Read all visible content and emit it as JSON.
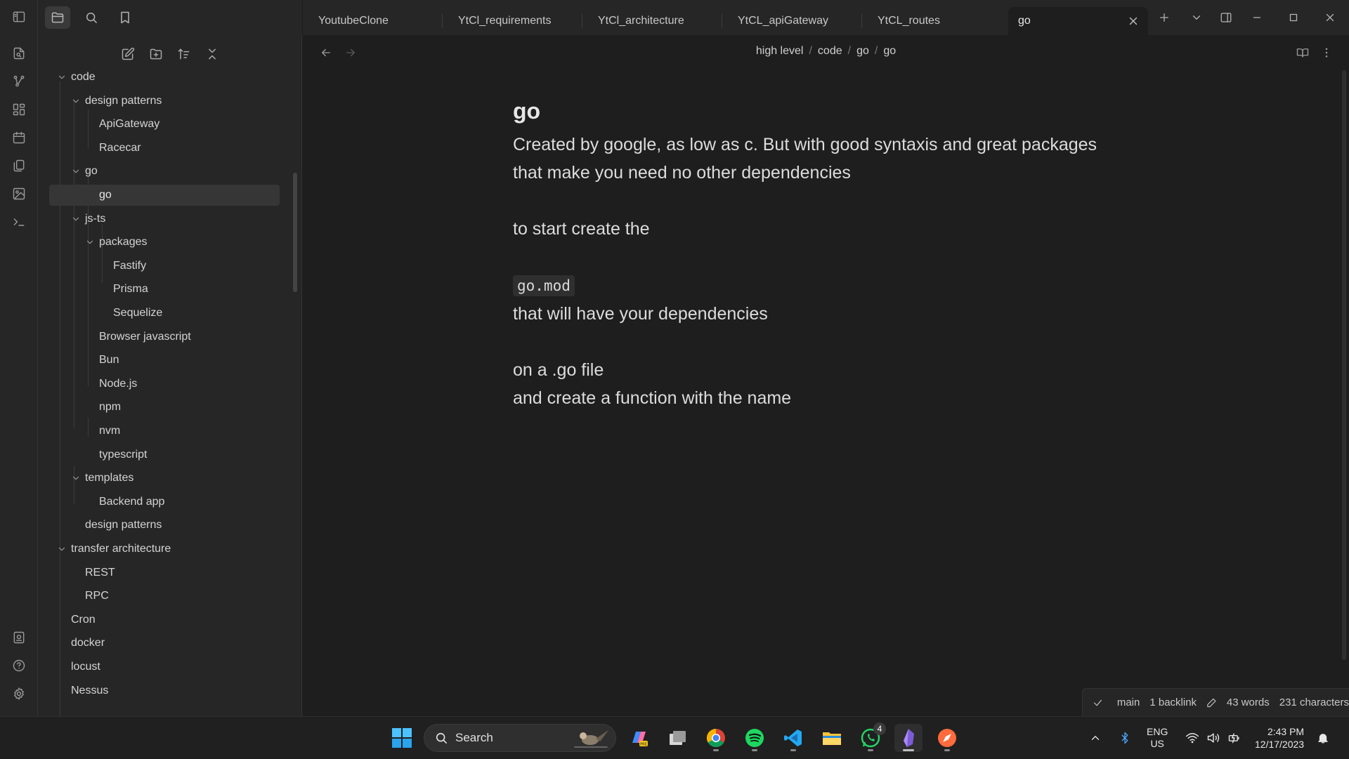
{
  "ribbon": {
    "icons": [
      "file-search-icon",
      "graph-icon",
      "canvas-icon",
      "calendar-icon",
      "pages-icon",
      "image-plot-icon",
      "terminal-icon",
      "vault-switcher-icon",
      "help-icon",
      "settings-icon"
    ]
  },
  "sidebar": {
    "tree": [
      {
        "label": "code",
        "depth": 1,
        "folder": true
      },
      {
        "label": "design patterns",
        "depth": 2,
        "folder": true
      },
      {
        "label": "ApiGateway",
        "depth": 3,
        "folder": false
      },
      {
        "label": "Racecar",
        "depth": 3,
        "folder": false
      },
      {
        "label": "go",
        "depth": 2,
        "folder": true
      },
      {
        "label": "go",
        "depth": 3,
        "folder": false,
        "selected": true
      },
      {
        "label": "js-ts",
        "depth": 2,
        "folder": true
      },
      {
        "label": "packages",
        "depth": 3,
        "folder": true
      },
      {
        "label": "Fastify",
        "depth": 4,
        "folder": false
      },
      {
        "label": "Prisma",
        "depth": 4,
        "folder": false
      },
      {
        "label": "Sequelize",
        "depth": 4,
        "folder": false
      },
      {
        "label": "Browser javascript",
        "depth": 3,
        "folder": false
      },
      {
        "label": "Bun",
        "depth": 3,
        "folder": false
      },
      {
        "label": "Node.js",
        "depth": 3,
        "folder": false
      },
      {
        "label": "npm",
        "depth": 3,
        "folder": false
      },
      {
        "label": "nvm",
        "depth": 3,
        "folder": false
      },
      {
        "label": "typescript",
        "depth": 3,
        "folder": false
      },
      {
        "label": "templates",
        "depth": 2,
        "folder": true
      },
      {
        "label": "Backend app",
        "depth": 3,
        "folder": false
      },
      {
        "label": "design patterns",
        "depth": 2,
        "folder": false
      },
      {
        "label": "transfer architecture",
        "depth": 1,
        "folder": true
      },
      {
        "label": "REST",
        "depth": 2,
        "folder": false
      },
      {
        "label": "RPC",
        "depth": 2,
        "folder": false
      },
      {
        "label": "Cron",
        "depth": 1,
        "folder": false
      },
      {
        "label": "docker",
        "depth": 1,
        "folder": false
      },
      {
        "label": "locust",
        "depth": 1,
        "folder": false
      },
      {
        "label": "Nessus",
        "depth": 1,
        "folder": false
      }
    ]
  },
  "tabs": [
    {
      "label": "YoutubeClone"
    },
    {
      "label": "YtCl_requirements"
    },
    {
      "label": "YtCl_architecture"
    },
    {
      "label": "YtCL_apiGateway"
    },
    {
      "label": "YtCL_routes"
    },
    {
      "label": "go",
      "active": true
    }
  ],
  "breadcrumb": [
    "high level",
    "code",
    "go",
    "go"
  ],
  "note": {
    "title": "go",
    "line1": "Created by google, as low as c. But with good syntaxis and great packages",
    "line2": "that make you need no other dependencies",
    "line3": "to start create the",
    "code": "go.mod",
    "line4": "that will have your dependencies",
    "line5": "on a .go file",
    "line6": "and create a function with the name"
  },
  "status": {
    "branch": "main",
    "backlinks": "1 backlink",
    "words": "43 words",
    "characters": "231 characters"
  },
  "taskbar": {
    "search_label": "Search",
    "whatsapp_badge": "4",
    "lang_top": "ENG",
    "lang_bottom": "US",
    "time": "2:43 PM",
    "date": "12/17/2023"
  }
}
